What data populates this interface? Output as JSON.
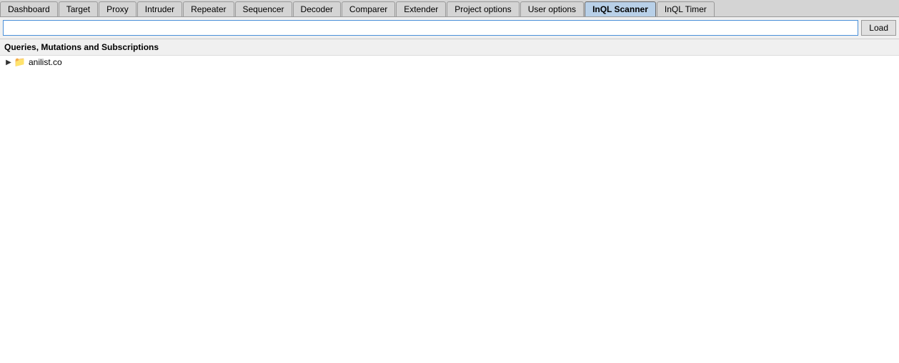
{
  "tabs": [
    {
      "id": "dashboard",
      "label": "Dashboard",
      "active": false
    },
    {
      "id": "target",
      "label": "Target",
      "active": false
    },
    {
      "id": "proxy",
      "label": "Proxy",
      "active": false
    },
    {
      "id": "intruder",
      "label": "Intruder",
      "active": false
    },
    {
      "id": "repeater",
      "label": "Repeater",
      "active": false
    },
    {
      "id": "sequencer",
      "label": "Sequencer",
      "active": false
    },
    {
      "id": "decoder",
      "label": "Decoder",
      "active": false
    },
    {
      "id": "comparer",
      "label": "Comparer",
      "active": false
    },
    {
      "id": "extender",
      "label": "Extender",
      "active": false
    },
    {
      "id": "project-options",
      "label": "Project options",
      "active": false
    },
    {
      "id": "user-options",
      "label": "User options",
      "active": false
    },
    {
      "id": "inql-scanner",
      "label": "InQL Scanner",
      "active": true
    },
    {
      "id": "inql-timer",
      "label": "InQL Timer",
      "active": false
    }
  ],
  "searchbar": {
    "placeholder": "",
    "value": "",
    "load_button_label": "Load"
  },
  "section": {
    "title": "Queries, Mutations and Subscriptions"
  },
  "tree": {
    "items": [
      {
        "id": "anilist",
        "label": "anilist.co",
        "expanded": false,
        "has_children": true
      }
    ]
  }
}
